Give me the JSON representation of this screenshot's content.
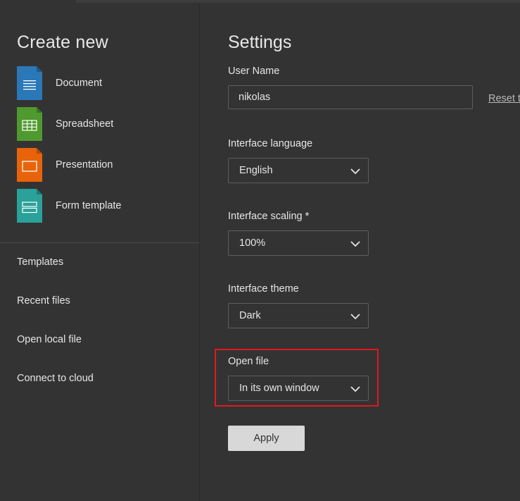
{
  "sidebar": {
    "create_title": "Create new",
    "create_items": [
      {
        "label": "Document",
        "icon": "document-icon",
        "color": "#2a78b8"
      },
      {
        "label": "Spreadsheet",
        "icon": "spreadsheet-icon",
        "color": "#4f9a2f"
      },
      {
        "label": "Presentation",
        "icon": "presentation-icon",
        "color": "#e8630a"
      },
      {
        "label": "Form template",
        "icon": "form-template-icon",
        "color": "#2aa19a"
      }
    ],
    "nav_items": [
      {
        "label": "Templates"
      },
      {
        "label": "Recent files"
      },
      {
        "label": "Open local file"
      },
      {
        "label": "Connect to cloud"
      }
    ]
  },
  "settings": {
    "title": "Settings",
    "user_name_label": "User Name",
    "user_name_value": "nikolas",
    "reset_label": "Reset t",
    "language_label": "Interface language",
    "language_value": "English",
    "scaling_label": "Interface scaling *",
    "scaling_value": "100%",
    "theme_label": "Interface theme",
    "theme_value": "Dark",
    "open_file_label": "Open file",
    "open_file_value": "In its own window",
    "apply_label": "Apply",
    "highlight_color": "#e0191d"
  }
}
